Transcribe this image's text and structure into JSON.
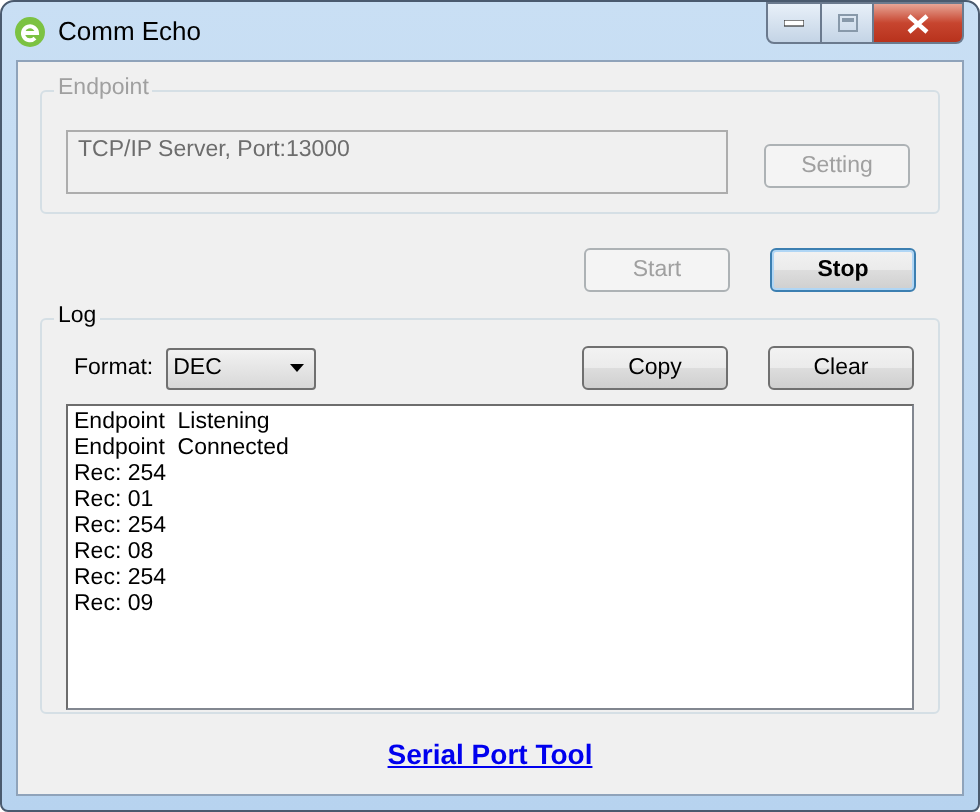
{
  "window": {
    "title": "Comm Echo"
  },
  "endpoint": {
    "label": "Endpoint",
    "disabled": true,
    "value": "TCP/IP Server, Port:13000",
    "setting_button": {
      "label": "Setting",
      "disabled": true
    }
  },
  "actions": [
    {
      "label": "Start",
      "disabled": true,
      "default": false
    },
    {
      "label": "Stop",
      "disabled": false,
      "default": true
    }
  ],
  "log": {
    "label": "Log",
    "format_label": "Format:",
    "format_value": "DEC",
    "buttons": [
      {
        "label": "Copy",
        "disabled": false
      },
      {
        "label": "Clear",
        "disabled": false
      }
    ],
    "lines": [
      "Endpoint  Listening",
      "Endpoint  Connected",
      "Rec: 254",
      "Rec: 01",
      "Rec: 254",
      "Rec: 08",
      "Rec: 254",
      "Rec: 09"
    ]
  },
  "link": "Serial Port Tool"
}
